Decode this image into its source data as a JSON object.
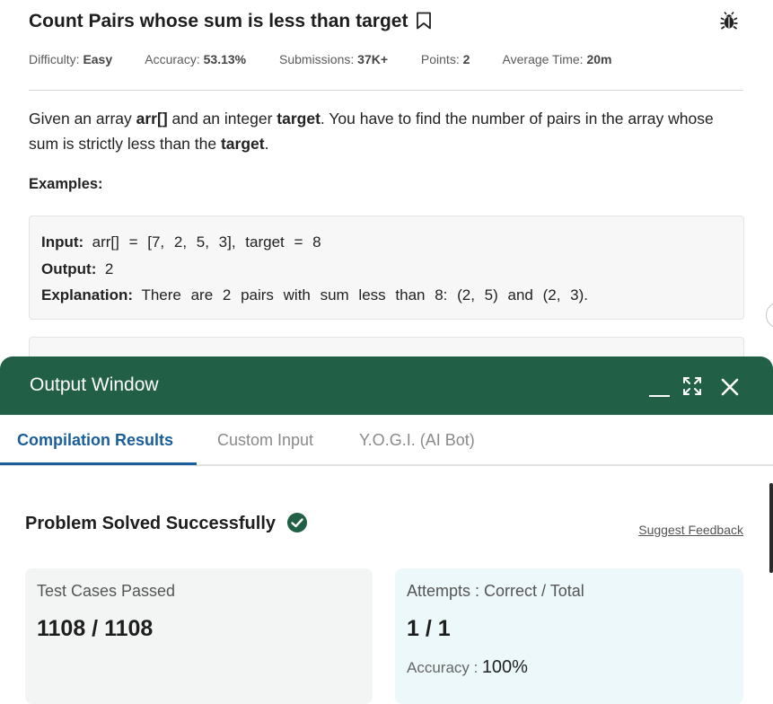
{
  "problem": {
    "title": "Count Pairs whose sum is less than target",
    "meta": [
      {
        "label": "Difficulty:",
        "value": "Easy"
      },
      {
        "label": "Accuracy:",
        "value": "53.13%"
      },
      {
        "label": "Submissions:",
        "value": "37K+"
      },
      {
        "label": "Points:",
        "value": "2"
      },
      {
        "label": "Average Time:",
        "value": "20m"
      }
    ],
    "description": {
      "p1": "Given an array ",
      "b1": "arr[]",
      "p2": " and an integer ",
      "b2": "target",
      "p3": ". You have to find the number of pairs in the array whose sum is strictly less than the ",
      "b3": "target",
      "p4": "."
    },
    "examples_heading": "Examples:",
    "example1": {
      "input_label": "Input:",
      "input_value": "arr[] = [7, 2, 5, 3], target = 8",
      "output_label": "Output:",
      "output_value": "2",
      "explanation_label": "Explanation:",
      "explanation_value": "There are 2 pairs with sum less than 8: (2, 5) and (2, 3)."
    }
  },
  "output_window": {
    "title": "Output Window",
    "tabs": [
      "Compilation Results",
      "Custom Input",
      "Y.O.G.I. (AI Bot)"
    ],
    "active_tab": 0,
    "status": "Problem Solved Successfully",
    "feedback_link": "Suggest Feedback",
    "test_cases": {
      "label": "Test Cases Passed",
      "value": "1108 / 1108"
    },
    "attempts": {
      "label": "Attempts : Correct / Total",
      "value": "1 / 1",
      "accuracy_label": "Accuracy :",
      "accuracy_value": "100%"
    }
  },
  "colors": {
    "header_green": "#216047",
    "tab_active_blue": "#1a5e9a",
    "check_green": "#216047"
  },
  "icons": {
    "bookmark": "bookmark-icon",
    "bug": "bug-icon",
    "minimize": "minimize-icon",
    "expand": "expand-icon",
    "close": "close-icon",
    "check": "check-circle-icon"
  }
}
